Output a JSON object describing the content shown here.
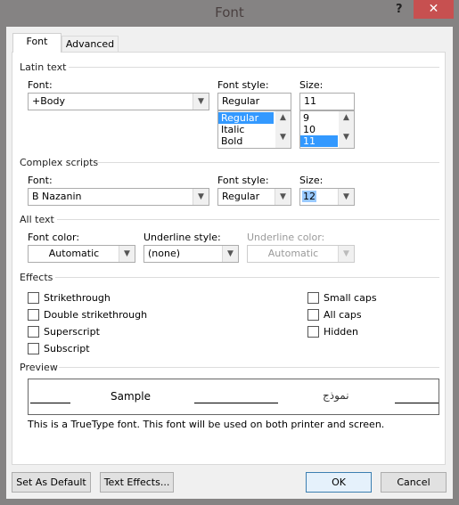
{
  "window": {
    "title": "Font",
    "help": "?",
    "close": "✕"
  },
  "tabs": [
    "Font",
    "Advanced"
  ],
  "latin": {
    "section": "Latin text",
    "font_label": "Font:",
    "font_value": "+Body",
    "style_label": "Font style:",
    "style_value": "Regular",
    "style_options": [
      "Regular",
      "Italic",
      "Bold"
    ],
    "style_selected": "Regular",
    "size_label": "Size:",
    "size_value": "11",
    "size_options": [
      "9",
      "10",
      "11"
    ],
    "size_selected": "11"
  },
  "complex": {
    "section": "Complex scripts",
    "font_label": "Font:",
    "font_value": "B Nazanin",
    "style_label": "Font style:",
    "style_value": "Regular",
    "size_label": "Size:",
    "size_value": "12"
  },
  "all_text": {
    "section": "All text",
    "color_label": "Font color:",
    "color_value": "Automatic",
    "underline_label": "Underline style:",
    "underline_value": "(none)",
    "ucolor_label": "Underline color:",
    "ucolor_value": "Automatic"
  },
  "effects": {
    "section": "Effects",
    "left": [
      {
        "label": "Strikethrough",
        "checked": false
      },
      {
        "label": "Double strikethrough",
        "checked": false
      },
      {
        "label": "Superscript",
        "checked": false
      },
      {
        "label": "Subscript",
        "checked": false
      }
    ],
    "right": [
      {
        "label": "Small caps",
        "checked": false
      },
      {
        "label": "All caps",
        "checked": false
      },
      {
        "label": "Hidden",
        "checked": false
      }
    ]
  },
  "preview": {
    "section": "Preview",
    "sample": "Sample",
    "sample_rtl": "نموذج",
    "note": "This is a TrueType font. This font will be used on both printer and screen."
  },
  "buttons": {
    "default": "Set As Default",
    "effects": "Text Effects...",
    "ok": "OK",
    "cancel": "Cancel"
  },
  "colors": {
    "selection": "#3399ff",
    "close": "#c75050"
  }
}
